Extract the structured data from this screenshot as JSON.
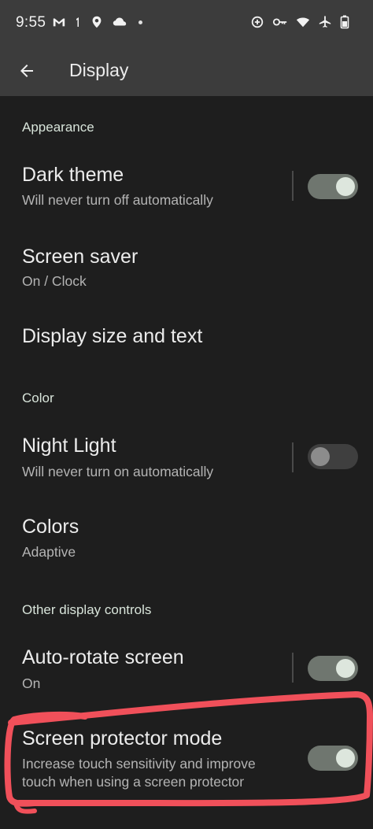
{
  "status_bar": {
    "time": "9:55",
    "left_icons": [
      "gmail-icon",
      "sim-one-icon",
      "location-icon",
      "cloud-icon",
      "dot-icon"
    ],
    "right_icons": [
      "data-saver-icon",
      "vpn-key-icon",
      "wifi-icon",
      "airplane-icon",
      "battery-icon"
    ]
  },
  "app_bar": {
    "title": "Display",
    "back_icon": "arrow-back-icon"
  },
  "sections": {
    "appearance": "Appearance",
    "color": "Color",
    "other": "Other display controls"
  },
  "items": {
    "dark_theme": {
      "title": "Dark theme",
      "subtitle": "Will never turn off automatically",
      "toggle": "on"
    },
    "screen_saver": {
      "title": "Screen saver",
      "subtitle": "On / Clock"
    },
    "display_size": {
      "title": "Display size and text"
    },
    "night_light": {
      "title": "Night Light",
      "subtitle": "Will never turn on automatically",
      "toggle": "off"
    },
    "colors": {
      "title": "Colors",
      "subtitle": "Adaptive"
    },
    "auto_rotate": {
      "title": "Auto-rotate screen",
      "subtitle": "On",
      "toggle": "on"
    },
    "screen_protector": {
      "title": "Screen protector mode",
      "subtitle_line1": "Increase touch sensitivity and improve",
      "subtitle_line2": "touch when using a screen protector",
      "toggle": "on"
    }
  },
  "colors": {
    "background": "#1e1e1e",
    "bar": "#3c3c3c",
    "accent_section": "#d8e4da",
    "annotation": "#f0505a"
  }
}
